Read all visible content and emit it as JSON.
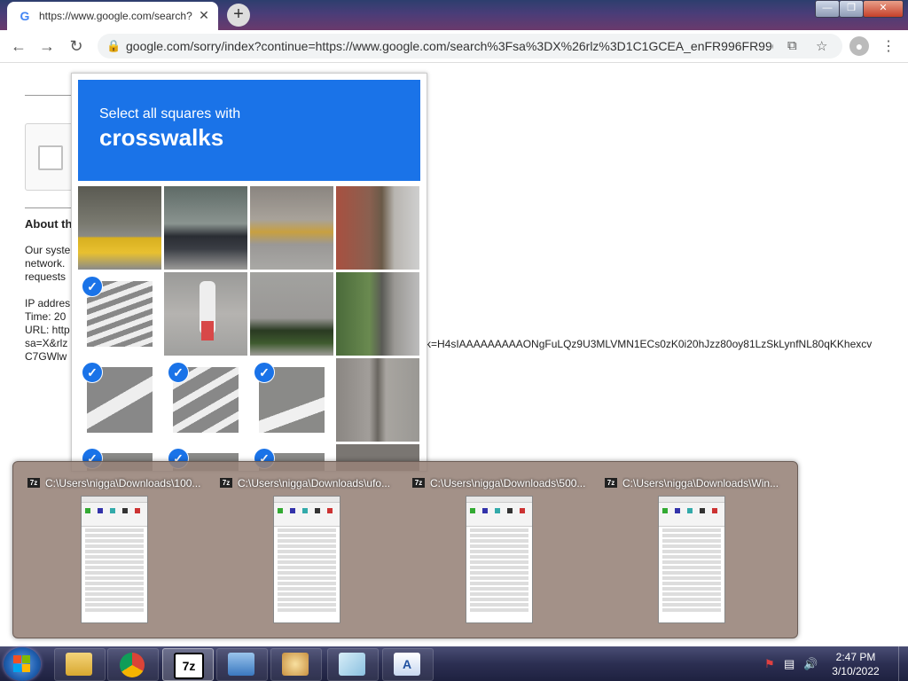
{
  "browser": {
    "tab_title": "https://www.google.com/search?",
    "tab_favicon": "G",
    "tab_close": "✕",
    "new_tab": "+",
    "url": "google.com/sorry/index?continue=https://www.google.com/search%3Fsa%3DX%26rlz%3D1C1GCEA_enFR996FR996...",
    "back": "←",
    "forward": "→",
    "reload": "↻",
    "window_minimize": "—",
    "window_restore": "❐",
    "window_close": "✕"
  },
  "page": {
    "about_heading": "About th",
    "paragraph_lines": [
      "Our syste",
      "network.",
      "requests"
    ],
    "ip_line": "IP addres",
    "time_line": "Time: 20",
    "url_line": "URL: http",
    "sa_line": "sa=X&rlz",
    "c7_line": "C7GWlw",
    "long_text": "k=H4sIAAAAAAAAAONgFuLQz9U3MLVMN1ECs0zK0i20hJzz80oy81LzSkLynfNL80qKKhexcv"
  },
  "captcha": {
    "prompt_line1": "Select all squares with",
    "prompt_line2": "crosswalks",
    "header_color": "#1a73e8",
    "check_mark": "✓"
  },
  "preview": {
    "windows": [
      {
        "title": "C:\\Users\\nigga\\Downloads\\100...",
        "icon": "7z"
      },
      {
        "title": "C:\\Users\\nigga\\Downloads\\ufo...",
        "icon": "7z"
      },
      {
        "title": "C:\\Users\\nigga\\Downloads\\500...",
        "icon": "7z"
      },
      {
        "title": "C:\\Users\\nigga\\Downloads\\Win...",
        "icon": "7z"
      }
    ]
  },
  "taskbar": {
    "apps": [
      "explorer-icon",
      "chrome-icon",
      "7zip-icon",
      "control-panel-icon",
      "paint-icon",
      "notepad-icon",
      "wordpad-icon"
    ],
    "active_app_label": "7z",
    "clock_time": "2:47 PM",
    "clock_date": "3/10/2022"
  }
}
